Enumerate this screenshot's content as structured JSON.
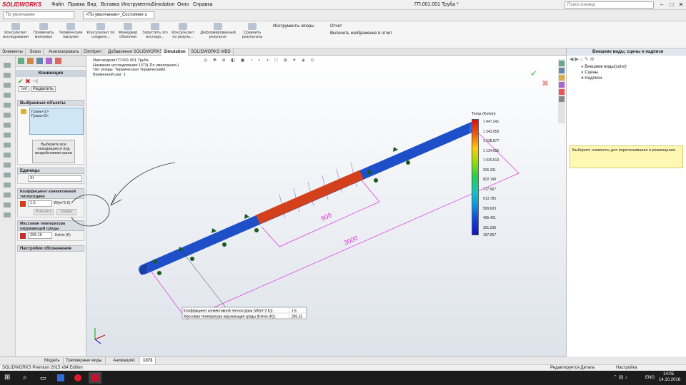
{
  "app": {
    "logo": "SOLIDWORKS",
    "doc_title": "ГП.001.001 Труба *",
    "search_placeholder": "Поиск команд"
  },
  "menu": [
    "Файл",
    "Правка",
    "Вид",
    "Вставка",
    "Инструменты",
    "Simulation",
    "Окно",
    "Справка"
  ],
  "config": {
    "left": "По умолчанию",
    "right": "<По умолчанию>_Состояние о"
  },
  "ribbon": [
    "Консультант исследования",
    "Применить материал",
    "Термические нагрузки",
    "Консультант по соедине...",
    "Менеджер оболочки",
    "Запустить это исследо...",
    "Консультант по резуль...",
    "Деформированный результат",
    "Сравнить результаты",
    "Инструменты эпюры",
    "Отчет",
    "Включить изображение в отчет"
  ],
  "tabs": [
    "Элементы",
    "Эскиз",
    "Анализировать",
    "DimXpert",
    "Добавления SOLIDWORKS",
    "Simulation",
    "SOLIDWORKS MBD"
  ],
  "panel": {
    "title": "Конвекция",
    "tab_type": "Тип",
    "tab_split": "Разделить",
    "selected_title": "Выбранные объекты",
    "faces": [
      "Грань<1>",
      "Грань<2>"
    ],
    "select_all": "Выберите все находящиеся под воздействием грани",
    "units_title": "Единицы",
    "units_value": "SI",
    "coef_title": "Коэффициент конвективной теплоотдачи",
    "coef_value": "1.5",
    "coef_unit": "W/(m^2.K)",
    "change_btn": "Изменить",
    "graph_btn": "График",
    "temp_title": "Массовая температура окружающей среды",
    "temp_value": "295.15",
    "temp_unit": "Kelvin (K)",
    "symbol_settings": "Настройки обозначения"
  },
  "viewport": {
    "info": [
      "Имя модели:ГП.001.001 Труба",
      "Название исследования:1373(-По умолчанию-)",
      "Тип эпюры: Термическая Термический1",
      "Временной шаг: 1"
    ],
    "dim_900": "900",
    "dim_3000": "3000",
    "callout_rows": [
      [
        "Коэффициент конвективной теплоотдачи (W/(m^2.K)):",
        "1.5"
      ],
      [
        "Массовая температура окружающей среды (Kelvin (K)):",
        "295.15"
      ]
    ],
    "legend_title": "Temp (Kelvin)",
    "legend_values": [
      "1 447.241",
      "1 343.059",
      "1 238.877",
      "1 134.695",
      "1 030.513",
      "926.331",
      "822.149",
      "717.967",
      "613.785",
      "509.603",
      "405.421",
      "301.239",
      "197.057"
    ]
  },
  "right_panel": {
    "title": "Внешние виды, сцены и надписи",
    "items": [
      "Внешние виды(color)",
      "Сцены",
      "Надписи"
    ],
    "hint": "Выберите элементы для перетаскивания и размещения."
  },
  "bottom_tabs": [
    "Модель",
    "Трехмерные виды",
    "Анимация1",
    "1373"
  ],
  "status": {
    "left": "SOLIDWORKS Premium 2015 x64 Edition",
    "mid": "Редактируется Деталь",
    "right": "Настройка"
  },
  "taskbar": {
    "lang": "ENG",
    "time": "14:05",
    "date": "14.10.2016"
  },
  "colors": {
    "pipe_blue": "#1f4fc8",
    "pipe_hot": "#d2401c",
    "accent": "#c8102e",
    "hint_bg": "#fff8b4",
    "dim_color": "#e030e0"
  }
}
